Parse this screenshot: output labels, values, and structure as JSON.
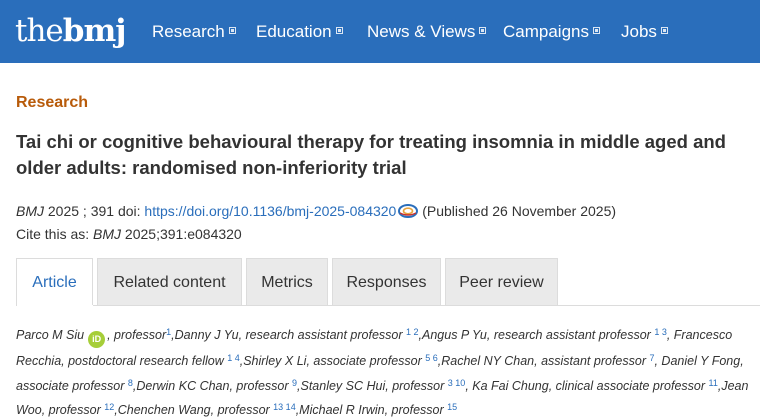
{
  "header": {
    "logo_the": "the",
    "logo_bmj": "bmj",
    "nav": [
      {
        "label": "Research"
      },
      {
        "label": "Education"
      },
      {
        "label": "News & Views"
      },
      {
        "label": "Campaigns"
      },
      {
        "label": "Jobs"
      }
    ]
  },
  "article": {
    "section": "Research",
    "title": "Tai chi or cognitive behavioural therapy for treating insomnia in middle aged and older adults: randomised non-inferiority trial",
    "journal": "BMJ",
    "year_volume": "2025 ; 391",
    "doi_label": "doi:",
    "doi_url": "https://doi.org/10.1136/bmj-2025-084320",
    "published": "(Published 26 November 2025)",
    "cite_as_label": "Cite this as:",
    "cite_as_journal": "BMJ",
    "cite_as_ref": "2025;391:e084320"
  },
  "tabs": [
    {
      "label": "Article",
      "active": true
    },
    {
      "label": "Related content"
    },
    {
      "label": "Metrics"
    },
    {
      "label": "Responses"
    },
    {
      "label": "Peer review"
    }
  ],
  "authors": [
    {
      "text": "Parco M Siu",
      "orcid": "iD",
      "role": ", professor",
      "sup": "1"
    },
    {
      "text": ",Danny J Yu, research assistant professor",
      "sup": "1 2"
    },
    {
      "text": ",Angus P Yu, research assistant professor",
      "sup": "1 3"
    },
    {
      "text": ", Francesco Recchia, postdoctoral research fellow",
      "sup": "1 4"
    },
    {
      "text": ",Shirley X Li, associate professor",
      "sup": "5 6"
    },
    {
      "text": ",Rachel NY Chan, assistant professor",
      "sup": "7"
    },
    {
      "text": ", Daniel Y Fong, associate professor",
      "sup": "8"
    },
    {
      "text": ",Derwin KC Chan, professor",
      "sup": "9"
    },
    {
      "text": ",Stanley SC Hui, professor",
      "sup": "3 10"
    },
    {
      "text": ", Ka Fai Chung, clinical associate professor",
      "sup": "11"
    },
    {
      "text": ",Jean Woo, professor",
      "sup": "12"
    },
    {
      "text": ",Chenchen Wang, professor",
      "sup": "13 14"
    },
    {
      "text": ",Michael R Irwin, professor",
      "sup": "15"
    }
  ],
  "colors": {
    "brand_blue": "#2a6ebb",
    "section_orange": "#b85b0a",
    "orcid_green": "#a6ce39"
  }
}
